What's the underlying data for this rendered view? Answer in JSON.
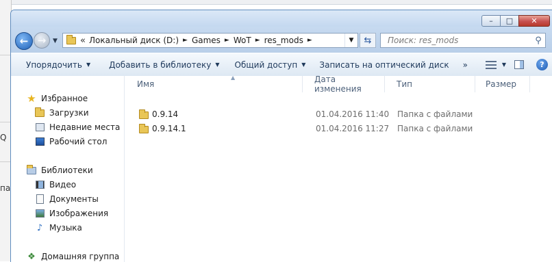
{
  "background_app": {
    "fragments": [
      "Q",
      "па"
    ]
  },
  "window": {
    "buttons": {
      "minimize": "–",
      "maximize": "□",
      "close": "✕"
    }
  },
  "address_bar": {
    "overflow": "«",
    "crumbs": [
      "Локальный диск (D:)",
      "Games",
      "WoT",
      "res_mods"
    ],
    "crumb_separator": "►"
  },
  "search": {
    "placeholder": "Поиск: res_mods",
    "icon": "search-icon"
  },
  "toolbar": {
    "items": [
      "Упорядочить",
      "Добавить в библиотеку",
      "Общий доступ",
      "Записать на оптический диск"
    ],
    "more": "»"
  },
  "nav": {
    "favorites": "Избранное",
    "downloads": "Загрузки",
    "recent": "Недавние места",
    "desktop": "Рабочий стол",
    "libraries": "Библиотеки",
    "video": "Видео",
    "documents": "Документы",
    "images": "Изображения",
    "music": "Музыка",
    "homegroup": "Домашняя группа"
  },
  "columns": {
    "name": "Имя",
    "date": "Дата изменения",
    "type": "Тип",
    "size": "Размер"
  },
  "files": [
    {
      "name": "0.9.14",
      "date": "01.04.2016 11:40",
      "type": "Папка с файлами",
      "size": ""
    },
    {
      "name": "0.9.14.1",
      "date": "01.04.2016 11:27",
      "type": "Папка с файлами",
      "size": ""
    }
  ],
  "colors": {
    "accent": "#2a6cc4",
    "folder": "#e9c657",
    "title_bar": "#c4d8f0"
  }
}
